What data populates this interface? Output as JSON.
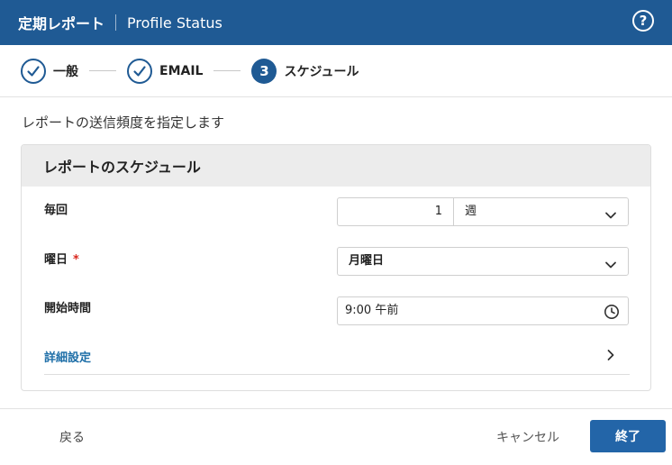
{
  "header": {
    "title": "定期レポート",
    "subtitle": "Profile Status",
    "help_icon": "question-circle-icon",
    "help_label": "?"
  },
  "stepper": {
    "steps": [
      {
        "label": "一般",
        "state": "done"
      },
      {
        "label": "EMAIL",
        "state": "done"
      },
      {
        "label": "スケジュール",
        "state": "active",
        "number": "3"
      }
    ]
  },
  "instruction": "レポートの送信頻度を指定します",
  "card": {
    "title": "レポートのスケジュール",
    "every": {
      "label": "毎回",
      "value": "1",
      "unit": "週"
    },
    "weekday": {
      "label": "曜日",
      "required_mark": "*",
      "value": "月曜日"
    },
    "start_time": {
      "label": "開始時間",
      "value": "9:00 午前"
    },
    "advanced": {
      "label": "詳細設定"
    }
  },
  "footer": {
    "back": "戻る",
    "cancel": "キャンセル",
    "finish": "終了"
  },
  "colors": {
    "brand": "#1f5a94",
    "primary_button": "#2365a8",
    "link": "#1f6fa8",
    "required": "#d9281e"
  }
}
